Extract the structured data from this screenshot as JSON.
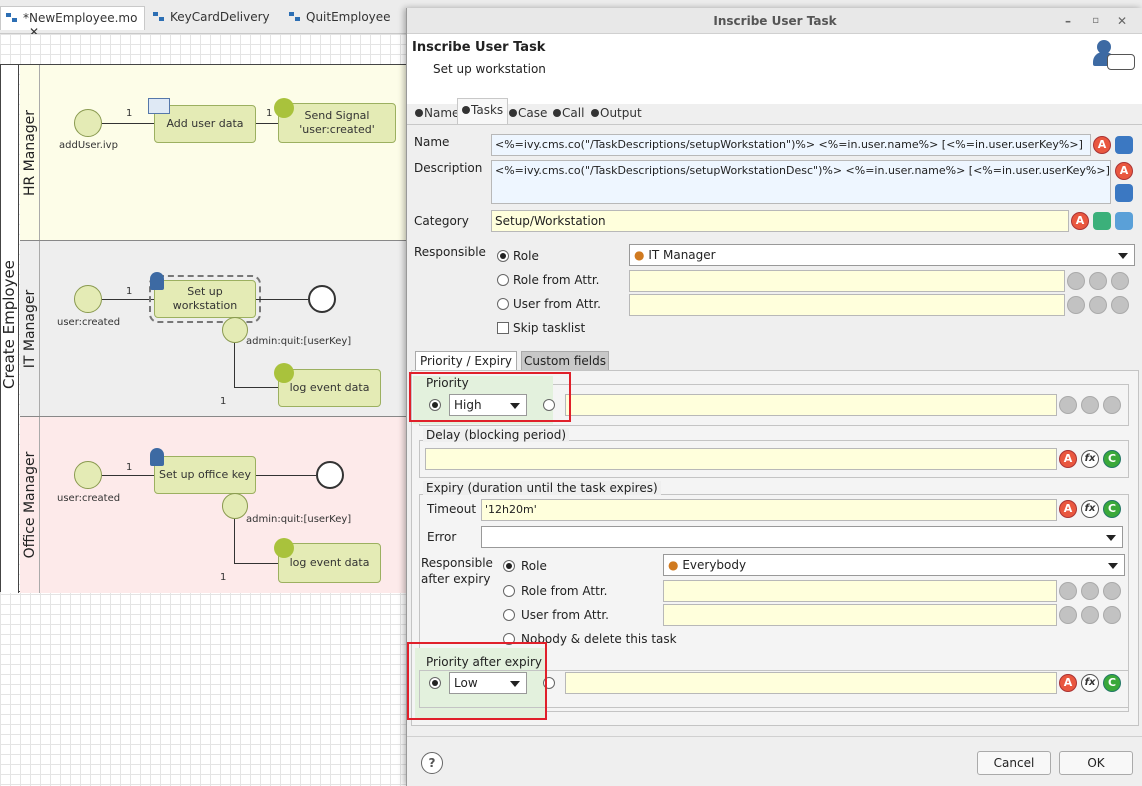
{
  "editor_tabs": [
    {
      "label": "*NewEmployee.mo",
      "active": true
    },
    {
      "label": "KeyCardDelivery",
      "active": false
    },
    {
      "label": "QuitEmployee",
      "active": false
    }
  ],
  "process": {
    "pool_label": "Create Employee",
    "lanes": [
      "HR Manager",
      "IT Manager",
      "Office Manager"
    ],
    "elements": {
      "add_user": "Add user data",
      "send_signal": "Send Signal\n'user:created'",
      "setup_ws": "Set up workstation",
      "log1": "log event data",
      "office_key": "Set up office key",
      "log2": "log event data"
    },
    "labels": {
      "start_hr": "addUser.ivp",
      "start_it": "user:created",
      "start_office": "user:created",
      "boundary_it": "admin:quit:[userKey]",
      "boundary_office": "admin:quit:[userKey]",
      "one": "1"
    }
  },
  "dialog": {
    "title": "Inscribe User Task",
    "header_title": "Inscribe User Task",
    "header_subtitle": "Set up workstation",
    "tabs": [
      "Name",
      "Tasks",
      "Case",
      "Call",
      "Output"
    ],
    "name_label": "Name",
    "name_value": "<%=ivy.cms.co(\"/TaskDescriptions/setupWorkstation\")%> <%=in.user.name%> [<%=in.user.userKey%>]",
    "description_label": "Description",
    "description_value": "<%=ivy.cms.co(\"/TaskDescriptions/setupWorkstationDesc\")%> <%=in.user.name%> [<%=in.user.userKey%>]",
    "category_label": "Category",
    "category_value": "Setup/Workstation",
    "responsible_label": "Responsible",
    "responsible_options": [
      "Role",
      "Role from Attr.",
      "User from Attr."
    ],
    "responsible_role": "IT Manager",
    "skip_tasklist": "Skip tasklist",
    "subtabs": [
      "Priority / Expiry",
      "Custom fields"
    ],
    "priority_label": "Priority",
    "priority_value": "High",
    "delay_label": "Delay (blocking period)",
    "expiry_label": "Expiry (duration until the task expires)",
    "timeout_label": "Timeout",
    "timeout_value": "'12h20m'",
    "error_label": "Error",
    "resp_after_label1": "Responsible",
    "resp_after_label2": "after expiry",
    "resp_after_options": [
      "Role",
      "Role from Attr.",
      "User from Attr.",
      "Nobody & delete this task"
    ],
    "resp_after_role": "Everybody",
    "priority_after_label": "Priority after expiry",
    "priority_after_value": "Low",
    "help": "?",
    "cancel": "Cancel",
    "ok": "OK",
    "icon_a": "A",
    "icon_f": "fx",
    "icon_c": "C"
  },
  "colors": {
    "highlight": "#e0202a",
    "lane_hr": "#fdfde8",
    "lane_it": "#eeeeee",
    "lane_office": "#fdeaea"
  }
}
